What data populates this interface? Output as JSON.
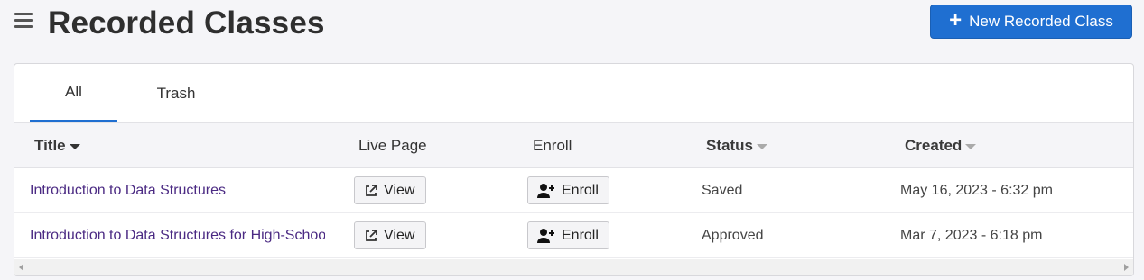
{
  "header": {
    "title": "Recorded Classes",
    "new_button_label": "New Recorded Class"
  },
  "tabs": [
    {
      "label": "All",
      "active": true
    },
    {
      "label": "Trash",
      "active": false
    }
  ],
  "table": {
    "columns": {
      "title": "Title",
      "live_page": "Live Page",
      "enroll": "Enroll",
      "status": "Status",
      "created": "Created"
    },
    "rows": [
      {
        "title": "Introduction to Data Structures",
        "view_label": "View",
        "enroll_label": "Enroll",
        "status": "Saved",
        "created": "May 16, 2023 - 6:32 pm"
      },
      {
        "title": "Introduction to Data Structures for High-School",
        "view_label": "View",
        "enroll_label": "Enroll",
        "status": "Approved",
        "created": "Mar 7, 2023 - 6:18 pm"
      }
    ]
  },
  "colors": {
    "accent": "#1f6fd1",
    "link": "#4b2a83"
  }
}
